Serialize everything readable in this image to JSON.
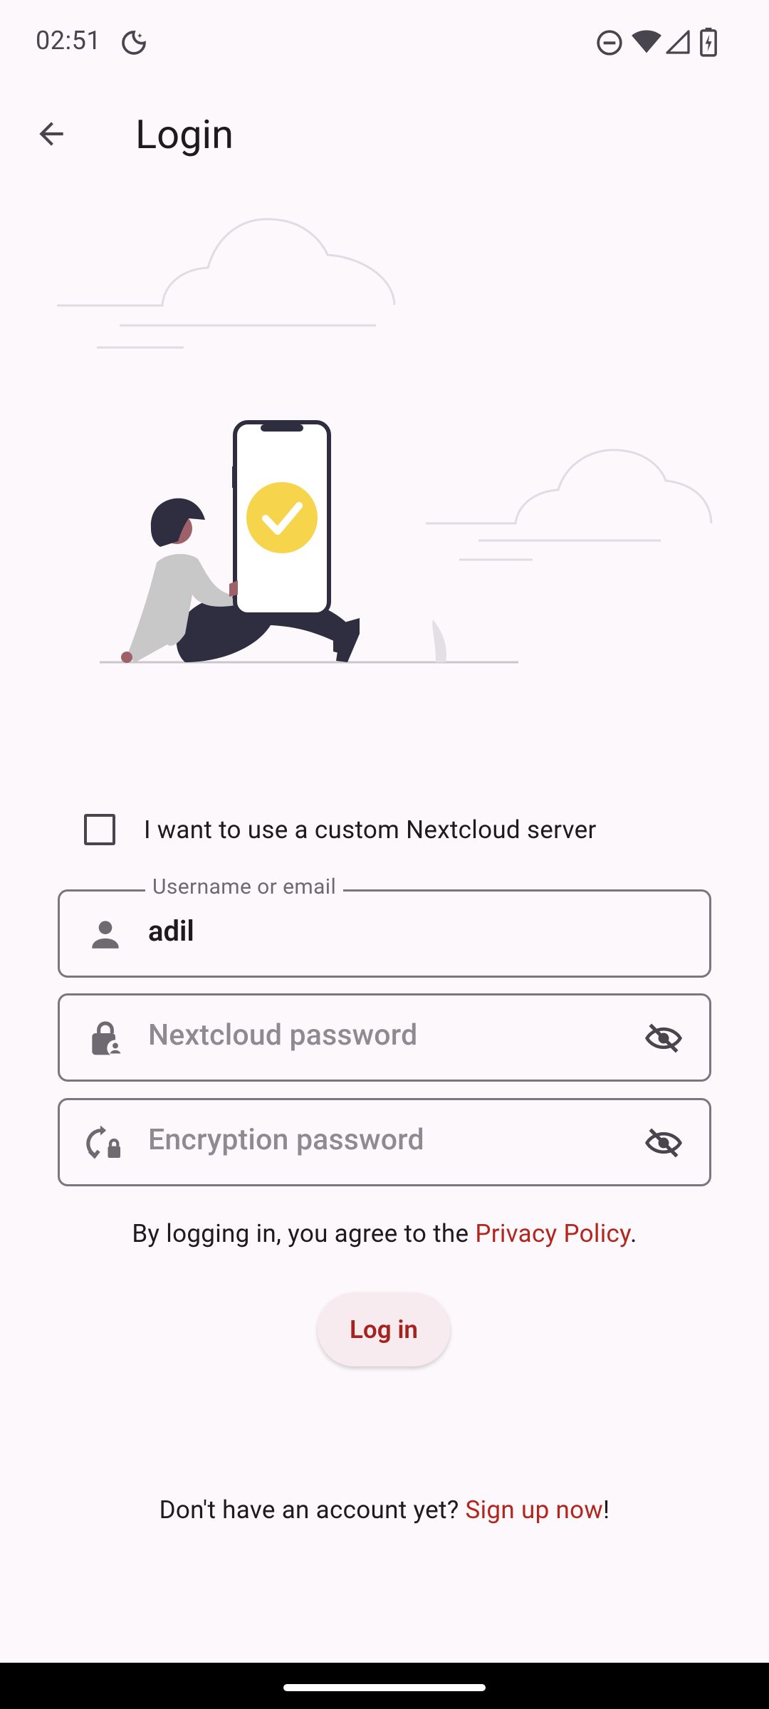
{
  "status_bar": {
    "time": "02:51",
    "icons": [
      "moon-icon",
      "do-not-disturb-icon",
      "wifi-icon",
      "signal-icon",
      "battery-charging-icon"
    ]
  },
  "app_bar": {
    "back_icon": "arrow-back-icon",
    "title": "Login"
  },
  "illustration": {
    "name": "person-with-phone-checkmark-illustration",
    "colors": {
      "accent": "#f6d54c",
      "dark": "#2f2e41",
      "lines": "#e0dde2"
    }
  },
  "custom_server": {
    "checked": false,
    "label": "I want to use a custom Nextcloud server"
  },
  "fields": {
    "username": {
      "label": "Username or email",
      "value": "adil",
      "icon": "person-icon"
    },
    "password": {
      "placeholder": "Nextcloud password",
      "icon": "lock-person-icon",
      "toggle_icon": "visibility-off-icon"
    },
    "encryption": {
      "placeholder": "Encryption password",
      "icon": "lock-reset-icon",
      "toggle_icon": "visibility-off-icon"
    }
  },
  "privacy": {
    "prefix": "By logging in, you agree to the ",
    "link": "Privacy Policy",
    "suffix": "."
  },
  "login_button": {
    "label": "Log in"
  },
  "signup": {
    "prefix": "Don't have an account yet? ",
    "link": "Sign up now",
    "suffix": "!"
  },
  "colors": {
    "background": "#fdf8fb",
    "accent": "#b3261e",
    "outline": "#7a757f"
  }
}
